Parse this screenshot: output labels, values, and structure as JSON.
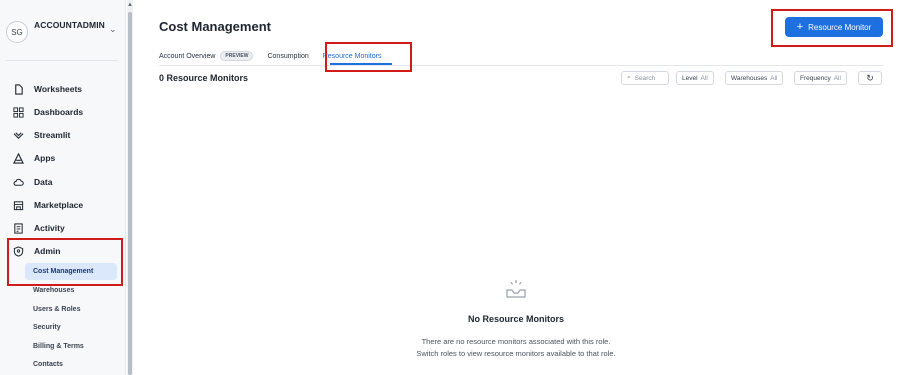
{
  "account": {
    "initials": "SG",
    "name": "ACCOUNTADMIN"
  },
  "nav": [
    {
      "label": "Worksheets",
      "icon": "file-icon"
    },
    {
      "label": "Dashboards",
      "icon": "grid-icon"
    },
    {
      "label": "Streamlit",
      "icon": "streamlit-icon"
    },
    {
      "label": "Apps",
      "icon": "apps-icon"
    },
    {
      "label": "Data",
      "icon": "cloud-icon"
    },
    {
      "label": "Marketplace",
      "icon": "store-icon"
    },
    {
      "label": "Activity",
      "icon": "activity-icon"
    },
    {
      "label": "Admin",
      "icon": "shield-icon"
    }
  ],
  "admin_sub": [
    {
      "label": "Cost Management",
      "active": true
    },
    {
      "label": "Warehouses"
    },
    {
      "label": "Users & Roles"
    },
    {
      "label": "Security"
    },
    {
      "label": "Billing & Terms"
    },
    {
      "label": "Contacts"
    }
  ],
  "page": {
    "title": "Cost Management",
    "primary_button": "Resource Monitor",
    "tabs": [
      {
        "label": "Account Overview",
        "badge": "PREVIEW"
      },
      {
        "label": "Consumption"
      },
      {
        "label": "Resource Monitors",
        "active": true
      }
    ],
    "count_label": "0 Resource Monitors",
    "filters": {
      "search": "Search",
      "level": {
        "label": "Level",
        "value": "All"
      },
      "warehouses": {
        "label": "Warehouses",
        "value": "All"
      },
      "frequency": {
        "label": "Frequency",
        "value": "All"
      }
    },
    "empty": {
      "title": "No Resource Monitors",
      "description": "There are no resource monitors associated with this role. Switch roles to view resource monitors available to that role."
    }
  },
  "colors": {
    "accent": "#1e6fe0",
    "annotation": "#d11a1a",
    "active_bg": "#dbe7fb"
  }
}
